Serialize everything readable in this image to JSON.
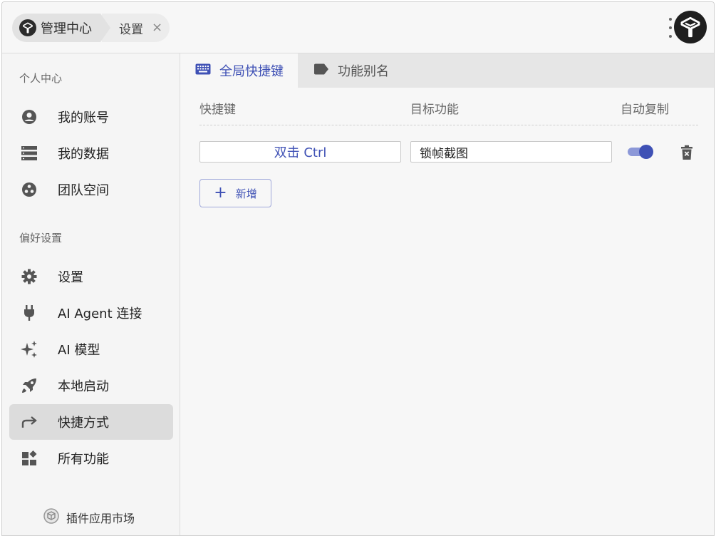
{
  "titlebar": {
    "breadcrumb": [
      "管理中心",
      "设置"
    ],
    "close_glyph": "×"
  },
  "sidebar": {
    "sections": [
      {
        "label": "个人中心",
        "items": [
          {
            "label": "我的账号",
            "icon": "account-circle-icon"
          },
          {
            "label": "我的数据",
            "icon": "storage-icon"
          },
          {
            "label": "团队空间",
            "icon": "team-icon"
          }
        ]
      },
      {
        "label": "偏好设置",
        "items": [
          {
            "label": "设置",
            "icon": "gear-icon"
          },
          {
            "label": "AI Agent 连接",
            "icon": "plug-icon"
          },
          {
            "label": "AI 模型",
            "icon": "sparkle-icon"
          },
          {
            "label": "本地启动",
            "icon": "rocket-icon"
          },
          {
            "label": "快捷方式",
            "icon": "shortcut-arrow-icon",
            "active": true
          },
          {
            "label": "所有功能",
            "icon": "widgets-icon"
          }
        ]
      }
    ],
    "market_label": "插件应用市场"
  },
  "main": {
    "tabs": [
      {
        "label": "全局快捷键",
        "icon": "keyboard-icon",
        "active": true
      },
      {
        "label": "功能别名",
        "icon": "label-icon",
        "active": false
      }
    ],
    "columns": [
      "快捷键",
      "目标功能",
      "自动复制"
    ],
    "rows": [
      {
        "shortcut": "双击 Ctrl",
        "target": "锁帧截图",
        "auto_copy": true
      }
    ],
    "add_label": "新增"
  },
  "colors": {
    "accent": "#3f51b5",
    "accent_light": "#8c98d8",
    "active_bg": "#dcdcdc"
  }
}
